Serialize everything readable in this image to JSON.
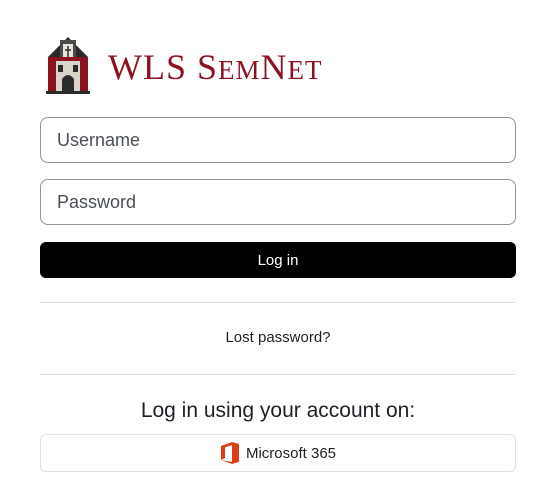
{
  "logo": {
    "text_big_1": "WLS ",
    "text_big_2": "S",
    "text_small_2": "EM",
    "text_big_3": "N",
    "text_small_3": "ET"
  },
  "form": {
    "username_placeholder": "Username",
    "password_placeholder": "Password",
    "login_label": "Log in"
  },
  "links": {
    "lost_password": "Lost password?"
  },
  "alternate": {
    "heading": "Log in using your account on:",
    "microsoft_label": "Microsoft 365"
  },
  "colors": {
    "brand": "#8b1320",
    "button": "#000000",
    "office_orange": "#dc3e15"
  }
}
